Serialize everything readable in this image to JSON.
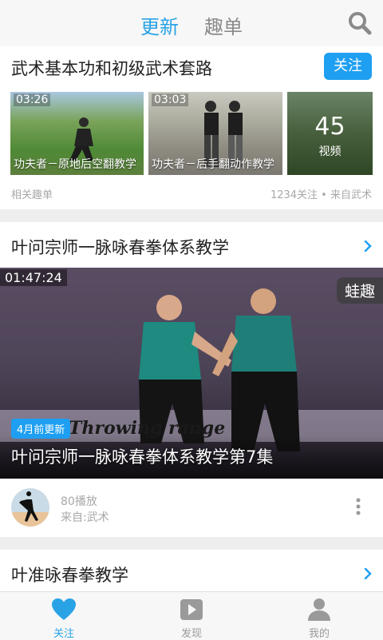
{
  "header": {
    "tabs": [
      {
        "label": "更新",
        "active": true
      },
      {
        "label": "趣单",
        "active": false
      }
    ],
    "search_icon": "search-icon"
  },
  "card1": {
    "title": "武术基本功和初级武术套路",
    "follow_label": "关注",
    "thumbs": [
      {
        "duration": "03:26",
        "caption": "功夫者－原地后空翻教学"
      },
      {
        "duration": "03:03",
        "caption": "功夫者－后手翻动作教学"
      }
    ],
    "more_count": "45",
    "more_label": "视频",
    "footer_left": "相关趣单",
    "footer_right": "1234关注 • 来自武术"
  },
  "card2": {
    "title": "叶问宗师一脉咏春拳体系教学",
    "video": {
      "duration": "01:47:24",
      "brand": "蛙趣",
      "update_badge": "4月前更新",
      "title": "叶问宗师一脉咏春拳体系教学第7集",
      "overlay_text": "Throwing range"
    },
    "plays": "80播放",
    "source": "来自:武术"
  },
  "card3": {
    "title": "叶准咏春拳教学"
  },
  "bottom_nav": [
    {
      "label": "关注",
      "icon": "heart-icon",
      "active": true
    },
    {
      "label": "发现",
      "icon": "play-icon",
      "active": false
    },
    {
      "label": "我的",
      "icon": "person-icon",
      "active": false
    }
  ],
  "colors": {
    "accent": "#1e9ff2",
    "tab_active": "#2aa3e6"
  }
}
